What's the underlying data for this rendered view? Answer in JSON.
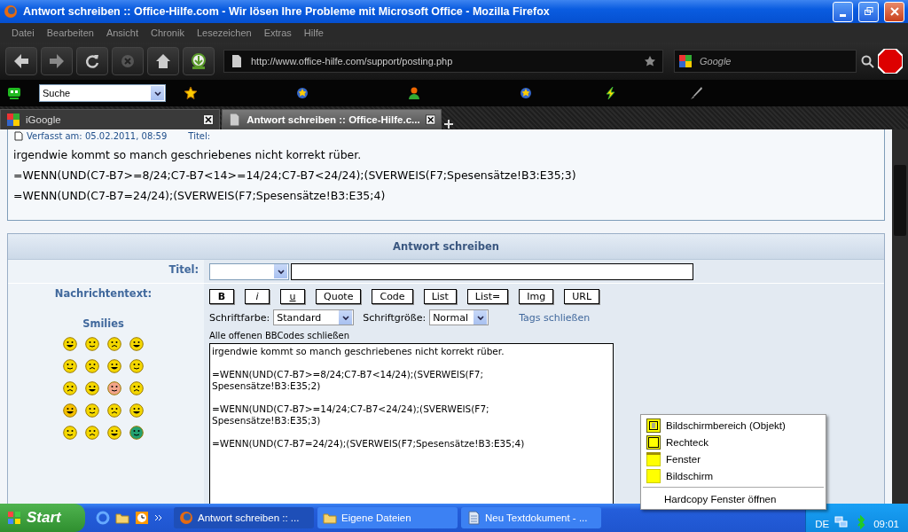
{
  "window": {
    "title": "Antwort schreiben :: Office-Hilfe.com - Wir lösen Ihre Probleme mit Microsoft Office - Mozilla Firefox"
  },
  "menu": [
    "Datei",
    "Bearbeiten",
    "Ansicht",
    "Chronik",
    "Lesezeichen",
    "Extras",
    "Hilfe"
  ],
  "navbar": {
    "url": "http://www.office-hilfe.com/support/posting.php",
    "search_placeholder": "Google"
  },
  "bookmarks": {
    "search_select": "Suche"
  },
  "tabs": [
    {
      "label": "iGoogle",
      "selected": false
    },
    {
      "label": "Antwort schreiben :: Office-Hilfe.c...",
      "selected": true
    }
  ],
  "post": {
    "meta": "Verfasst am: 05.02.2011, 08:59",
    "title_label": "Titel:",
    "lines": [
      "irgendwie kommt so manch geschriebenes nicht korrekt rüber.",
      "=WENN(UND(C7-B7>=8/24;C7-B7<14>=14/24;C7-B7<24/24);(SVERWEIS(F7;Spesensätze!B3:E35;3)",
      "=WENN(UND(C7-B7=24/24);(SVERWEIS(F7;Spesensätze!B3:E35;4)"
    ]
  },
  "form": {
    "heading": "Antwort schreiben",
    "title_label": "Titel:",
    "message_label": "Nachrichtentext:",
    "smilies_label": "Smilies",
    "format_buttons": [
      {
        "label": "B",
        "kind": "bold"
      },
      {
        "label": "i",
        "kind": "italic"
      },
      {
        "label": "u",
        "kind": "underline"
      },
      {
        "label": "Quote",
        "kind": "plain"
      },
      {
        "label": "Code",
        "kind": "plain"
      },
      {
        "label": "List",
        "kind": "plain"
      },
      {
        "label": "List=",
        "kind": "plain"
      },
      {
        "label": "Img",
        "kind": "plain"
      },
      {
        "label": "URL",
        "kind": "plain"
      }
    ],
    "color_label": "Schriftfarbe:",
    "color_value": "Standard",
    "size_label": "Schriftgröße:",
    "size_value": "Normal",
    "close_tags": "Tags schließen",
    "close_all": "Alle offenen BBCodes schließen",
    "message": "irgendwie kommt so manch geschriebenes nicht korrekt rüber.\n\n=WENN(UND(C7-B7>=8/24;C7-B7<14/24);(SVERWEIS(F7;\nSpesensätze!B3:E35;2)\n\n=WENN(UND(C7-B7>=14/24;C7-B7<24/24);(SVERWEIS(F7;\nSpesensätze!B3:E35;3)\n\n=WENN(UND(C7-B7=24/24);(SVERWEIS(F7;Spesensätze!B3:E35;4)"
  },
  "context_menu": [
    {
      "label": "Bildschirmbereich (Objekt)",
      "kind": "region"
    },
    {
      "label": "Rechteck",
      "kind": "rectangle"
    },
    {
      "label": "Fenster",
      "kind": "window"
    },
    {
      "label": "Bildschirm",
      "kind": "screen"
    },
    {
      "label": "Hardcopy Fenster öffnen",
      "kind": "plain"
    }
  ],
  "taskbar": {
    "start": "Start",
    "tasks": [
      {
        "label": "Antwort schreiben :: ...",
        "kind": "browser"
      },
      {
        "label": "Eigene Dateien",
        "kind": "folder"
      },
      {
        "label": "Neu Textdokument - ...",
        "kind": "document"
      }
    ],
    "language": "DE",
    "clock": "09:01"
  }
}
